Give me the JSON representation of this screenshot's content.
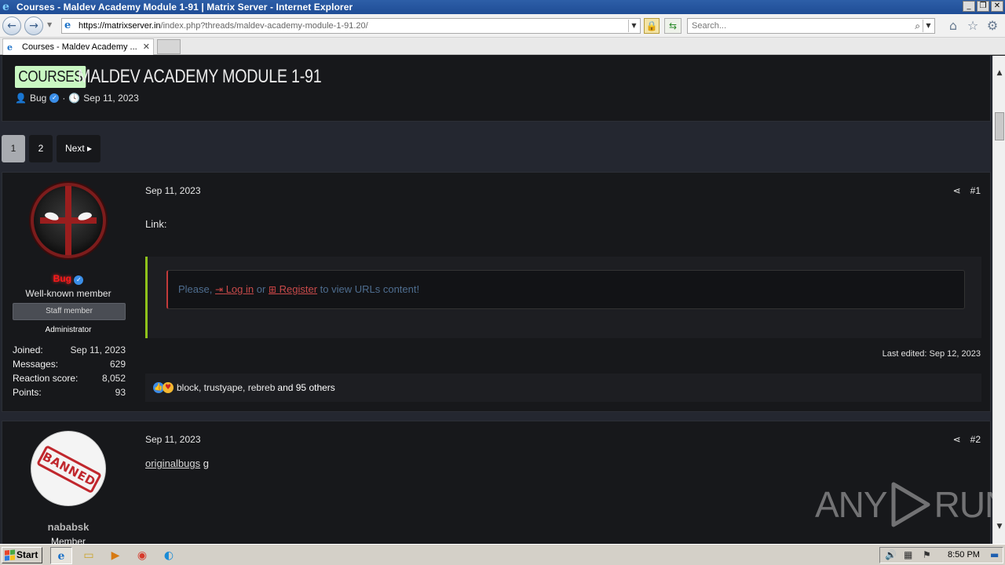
{
  "window": {
    "title": "Courses - Maldev Academy Module 1-91 | Matrix Server - Internet Explorer",
    "minimize": "_",
    "restore": "❐",
    "close": "✕"
  },
  "address_bar": {
    "url_host": "https://matrixserver.in",
    "url_path": "/index.php?threads/maldev-academy-module-1-91.20/",
    "search_placeholder": "Search..."
  },
  "tab": {
    "label": "Courses - Maldev Academy ...",
    "close": "✕"
  },
  "thread": {
    "prefix": "COURSES",
    "title": "MALDEV ACADEMY MODULE 1-91",
    "author": "Bug",
    "date": "Sep 11, 2023"
  },
  "pagination": {
    "pages": [
      "1",
      "2"
    ],
    "current": "1",
    "next": "Next ▸"
  },
  "posts": [
    {
      "username": "Bug",
      "user_title": "Well-known member",
      "staff_badge": "Staff member",
      "role": "Administrator",
      "stats": [
        {
          "label": "Joined:",
          "value": "Sep 11, 2023"
        },
        {
          "label": "Messages:",
          "value": "629"
        },
        {
          "label": "Reaction score:",
          "value": "8,052"
        },
        {
          "label": "Points:",
          "value": "93"
        }
      ],
      "date": "Sep 11, 2023",
      "number": "#1",
      "body": "Link:",
      "gate": {
        "prefix": "Please,",
        "login": "Log in",
        "or": "or",
        "register": "Register",
        "suffix": "to view URLs content!"
      },
      "last_edited": "Last edited: Sep 12, 2023",
      "reactions": {
        "names": "block, trustyape, rebreb",
        "others": "and 95 others"
      }
    },
    {
      "username": "nababsk",
      "user_title": "Member",
      "avatar_stamp": "BANNED",
      "date": "Sep 11, 2023",
      "number": "#2",
      "body_link": "originalbugs",
      "body_text": " g"
    }
  ],
  "watermark": {
    "left": "ANY",
    "right": "RUN"
  },
  "taskbar": {
    "start": "Start",
    "clock": "8:50 PM"
  },
  "colors": {
    "prefix_bg": "#c9f7c2",
    "admin_name": "#ff1a1a",
    "quote_border": "#8fc21b",
    "gate_link": "#c84a4a"
  }
}
